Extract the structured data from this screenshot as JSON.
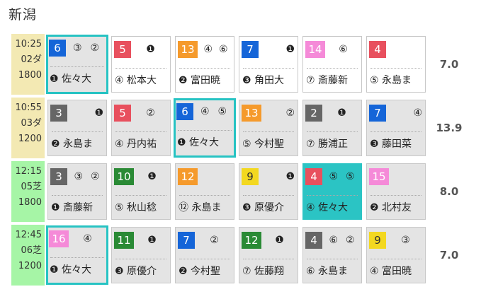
{
  "venue": "新潟",
  "rows": [
    {
      "time": "10:25",
      "race": "02ダ",
      "distance": "1800",
      "surface": "dirt",
      "odds": "7.0",
      "cells": [
        {
          "num": "6",
          "color": "#1565d8",
          "marks": "③ ②",
          "jockey": "❶ 佐々大",
          "style": "hl gray"
        },
        {
          "num": "5",
          "color": "#e8505e",
          "marks": "❶",
          "jockey": "④ 松本大",
          "style": ""
        },
        {
          "num": "13",
          "color": "#f59a2c",
          "marks": "④ ⑥",
          "jockey": "❷ 富田暁",
          "style": ""
        },
        {
          "num": "7",
          "color": "#1565d8",
          "marks": "❶",
          "jockey": "❸ 角田大",
          "style": "",
          "far": true
        },
        {
          "num": "14",
          "color": "#f58ad8",
          "marks": "⑥",
          "jockey": "⑦ 斎藤新",
          "style": ""
        },
        {
          "num": "4",
          "color": "#e8505e",
          "marks": "",
          "jockey": "⑤ 永島ま",
          "style": ""
        }
      ]
    },
    {
      "time": "10:55",
      "race": "03ダ",
      "distance": "1200",
      "surface": "dirt",
      "odds": "13.9",
      "cells": [
        {
          "num": "3",
          "color": "#666666",
          "marks": "❶",
          "jockey": "❷ 永島ま",
          "style": "gray",
          "far": true
        },
        {
          "num": "5",
          "color": "#e8505e",
          "marks": "②",
          "jockey": "④ 丹内祐",
          "style": "gray"
        },
        {
          "num": "6",
          "color": "#1565d8",
          "marks": "④ ⑤",
          "jockey": "❶ 佐々大",
          "style": "hl gray"
        },
        {
          "num": "13",
          "color": "#f59a2c",
          "marks": "②",
          "jockey": "⑤ 今村聖",
          "style": "gray",
          "far": true
        },
        {
          "num": "2",
          "color": "#666666",
          "marks": "❶",
          "jockey": "⑦ 勝浦正",
          "style": "gray"
        },
        {
          "num": "7",
          "color": "#1565d8",
          "marks": "④",
          "jockey": "❸ 藤田菜",
          "style": "gray",
          "far": true
        }
      ]
    },
    {
      "time": "12:15",
      "race": "05芝",
      "distance": "1800",
      "surface": "turf",
      "odds": "8.0",
      "cells": [
        {
          "num": "3",
          "color": "#666666",
          "marks": "③ ②",
          "jockey": "❶ 斎藤新",
          "style": "gray"
        },
        {
          "num": "10",
          "color": "#2a8a35",
          "marks": "❶",
          "jockey": "⑤ 秋山稔",
          "style": "gray"
        },
        {
          "num": "12",
          "color": "#f59a2c",
          "marks": "",
          "jockey": "⑫ 永島ま",
          "style": "gray"
        },
        {
          "num": "9",
          "color": "#f3d820",
          "marks": "❶",
          "jockey": "❸ 原優介",
          "style": "gray",
          "far": true
        },
        {
          "num": "4",
          "color": "#e8505e",
          "marks": "⑤ ⑤",
          "jockey": "④ 佐々大",
          "style": "filled"
        },
        {
          "num": "15",
          "color": "#f58ad8",
          "marks": "",
          "jockey": "❷ 北村友",
          "style": "gray"
        }
      ]
    },
    {
      "time": "12:45",
      "race": "06芝",
      "distance": "1200",
      "surface": "turf",
      "odds": "7.0",
      "cells": [
        {
          "num": "16",
          "color": "#f58ad8",
          "marks": "④",
          "jockey": "❶ 佐々大",
          "style": "hl gray"
        },
        {
          "num": "11",
          "color": "#2a8a35",
          "marks": "❶",
          "jockey": "❸ 原優介",
          "style": "gray"
        },
        {
          "num": "7",
          "color": "#1565d8",
          "marks": "②",
          "jockey": "❷ 今村聖",
          "style": "gray"
        },
        {
          "num": "12",
          "color": "#2a8a35",
          "marks": "❶",
          "jockey": "⑦ 佐藤翔",
          "style": "gray"
        },
        {
          "num": "4",
          "color": "#666666",
          "marks": "⑥ ②",
          "jockey": "⑥ 永島ま",
          "style": "gray"
        },
        {
          "num": "9",
          "color": "#f3d820",
          "marks": "③",
          "jockey": "④ 富田暁",
          "style": "gray"
        }
      ]
    }
  ]
}
